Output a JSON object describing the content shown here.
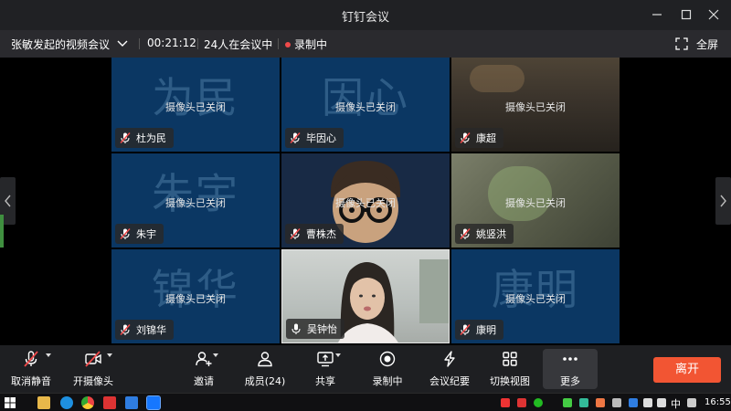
{
  "window": {
    "title": "钉钉会议"
  },
  "infobar": {
    "meeting_name": "张敏发起的视频会议",
    "duration": "00:21:12",
    "participants_in_meeting": "24人在会议中",
    "recording": "录制中",
    "fullscreen": "全屏"
  },
  "camera_off_text": "摄像头已关闭",
  "tiles": [
    {
      "name": "杜为民",
      "big_text": "为民",
      "camera_off": true,
      "muted": true,
      "background": "#0b3763"
    },
    {
      "name": "毕因心",
      "big_text": "因心",
      "camera_off": true,
      "muted": true,
      "background": "#0b3763"
    },
    {
      "name": "康超",
      "big_text": "",
      "camera_off": true,
      "muted": true,
      "background": "#3a332b"
    },
    {
      "name": "朱宇",
      "big_text": "朱宇",
      "camera_off": true,
      "muted": true,
      "background": "#0b3763"
    },
    {
      "name": "曹株杰",
      "big_text": "",
      "camera_off": true,
      "muted": true,
      "background": "#182a45"
    },
    {
      "name": "姚竖洪",
      "big_text": "",
      "camera_off": true,
      "muted": true,
      "background": "#4a4f3e"
    },
    {
      "name": "刘锦华",
      "big_text": "锦华",
      "camera_off": true,
      "muted": true,
      "background": "#0b3763"
    },
    {
      "name": "吴钟怡",
      "big_text": "",
      "camera_off": false,
      "muted": false,
      "background": "#b9bfbc"
    },
    {
      "name": "康明",
      "big_text": "康明",
      "camera_off": true,
      "muted": true,
      "background": "#0b3763"
    }
  ],
  "toolbar": {
    "unmute": "取消静音",
    "camera_on": "开摄像头",
    "invite": "邀请",
    "members": "成员(24)",
    "share": "共享",
    "recording": "录制中",
    "minutes": "会议纪要",
    "switch_view": "切换视图",
    "more": "更多",
    "leave": "离开"
  },
  "taskbar": {
    "ime": "中",
    "clock": "16:55"
  },
  "colors": {
    "tile_blue": "#0b3763",
    "leave_button": "#f25533",
    "recording_dot": "#f04a4a",
    "toolbar_bg": "#1e1f22"
  }
}
